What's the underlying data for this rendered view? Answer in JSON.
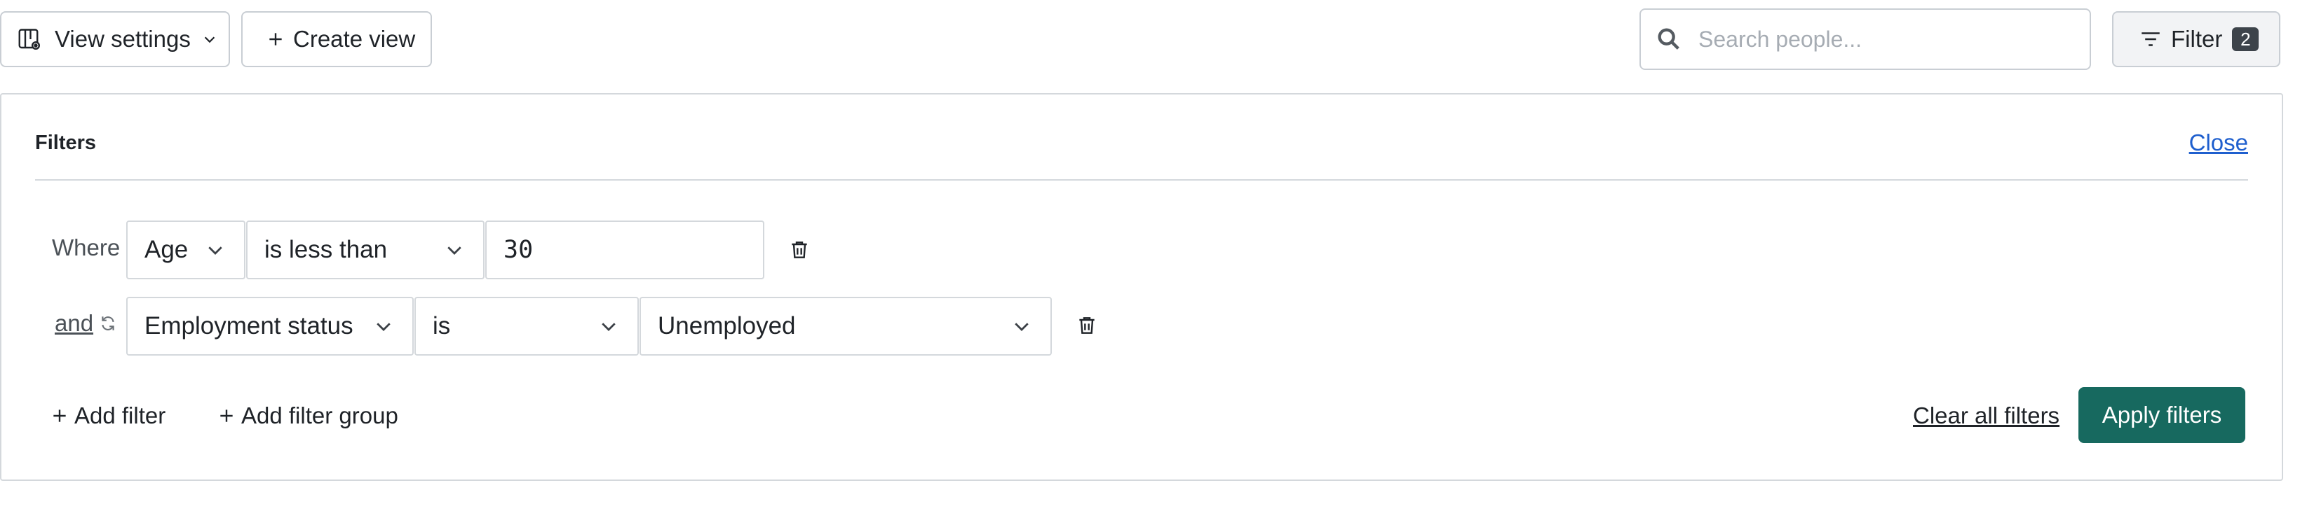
{
  "toolbar": {
    "view_settings_label": "View settings",
    "create_view_label": "Create view",
    "search_placeholder": "Search people...",
    "filter_label": "Filter",
    "filter_count": "2"
  },
  "filters_panel": {
    "title": "Filters",
    "close_label": "Close",
    "rows": [
      {
        "connector": "Where",
        "field": "Age",
        "operator": "is less than",
        "value": "30"
      },
      {
        "connector": "and",
        "field": "Employment status",
        "operator": "is",
        "value": "Unemployed"
      }
    ],
    "add_filter_label": "Add filter",
    "add_filter_group_label": "Add filter group",
    "clear_all_label": "Clear all filters",
    "apply_label": "Apply filters"
  },
  "colors": {
    "accent": "#17695f",
    "link": "#1f5fce",
    "badge": "#3d434a"
  },
  "icons": {
    "view_settings": "layout-settings-icon",
    "dropdown": "chevron-down-icon",
    "create": "plus-icon",
    "search": "search-icon",
    "filter": "filter-lines-icon",
    "delete": "trash-icon",
    "connector_toggle": "swap-icon"
  }
}
